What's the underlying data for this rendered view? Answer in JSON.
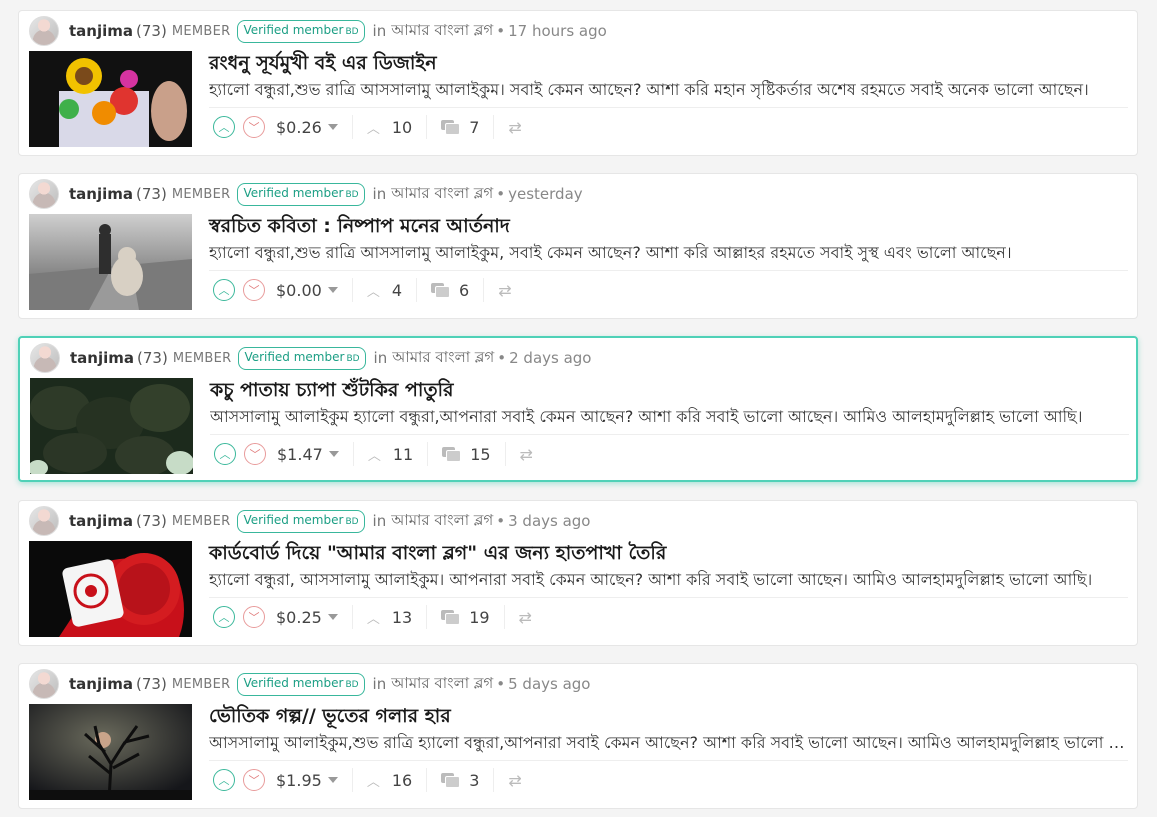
{
  "posts": [
    {
      "author": "tanjima",
      "reputation": "(73)",
      "role": "MEMBER",
      "badge": "Verified member",
      "badge_sub": "BD",
      "in_label": "in",
      "community": "আমার বাংলা ব্লগ",
      "time": "17 hours ago",
      "title": "রংধনু সূর্যমুখী বই এর ডিজাইন",
      "body": "হ্যালো বন্ধুরা,শুভ রাত্রি আসসালামু আলাইকুম। সবাই কেমন আছেন? আশা করি মহান সৃষ্টিকর্তার অশেষ রহমতে সবাই অনেক ভালো আছেন।",
      "payout": "$0.26",
      "votes": "10",
      "replies": "7",
      "highlighted": false
    },
    {
      "author": "tanjima",
      "reputation": "(73)",
      "role": "MEMBER",
      "badge": "Verified member",
      "badge_sub": "BD",
      "in_label": "in",
      "community": "আমার বাংলা ব্লগ",
      "time": "yesterday",
      "title": "স্বরচিত কবিতা : নিষ্পাপ মনের আর্তনাদ",
      "body": "হ্যালো বন্ধুরা,শুভ রাত্রি আসসালামু আলাইকুম, সবাই কেমন আছেন? আশা করি আল্লাহর রহমতে সবাই সুস্থ এবং ভালো আছেন।",
      "payout": "$0.00",
      "votes": "4",
      "replies": "6",
      "highlighted": false
    },
    {
      "author": "tanjima",
      "reputation": "(73)",
      "role": "MEMBER",
      "badge": "Verified member",
      "badge_sub": "BD",
      "in_label": "in",
      "community": "আমার বাংলা ব্লগ",
      "time": "2 days ago",
      "title": "কচু পাতায় চ্যাপা শুঁটকির পাতুরি",
      "body": "আসসালামু আলাইকুম হ্যালো বন্ধুরা,আপনারা সবাই কেমন আছেন? আশা করি সবাই ভালো আছেন। আমিও আলহামদুলিল্লাহ ভালো আছি।",
      "payout": "$1.47",
      "votes": "11",
      "replies": "15",
      "highlighted": true
    },
    {
      "author": "tanjima",
      "reputation": "(73)",
      "role": "MEMBER",
      "badge": "Verified member",
      "badge_sub": "BD",
      "in_label": "in",
      "community": "আমার বাংলা ব্লগ",
      "time": "3 days ago",
      "title": "কার্ডবোর্ড দিয়ে \"আমার বাংলা ব্লগ\" এর জন্য হাতপাখা তৈরি",
      "body": "হ্যালো বন্ধুরা, আসসালামু আলাইকুম। আপনারা সবাই কেমন আছেন? আশা করি সবাই ভালো আছেন। আমিও আলহামদুলিল্লাহ ভালো আছি।",
      "payout": "$0.25",
      "votes": "13",
      "replies": "19",
      "highlighted": false
    },
    {
      "author": "tanjima",
      "reputation": "(73)",
      "role": "MEMBER",
      "badge": "Verified member",
      "badge_sub": "BD",
      "in_label": "in",
      "community": "আমার বাংলা ব্লগ",
      "time": "5 days ago",
      "title": "ভৌতিক গল্প// ভূতের গলার হার",
      "body": "আসসালামু আলাইকুম,শুভ রাত্রি হ্যালো বন্ধুরা,আপনারা সবাই কেমন আছেন? আশা করি সবাই ভালো আছেন। আমিও আলহামদুলিল্লাহ ভালো আছি।",
      "payout": "$1.95",
      "votes": "16",
      "replies": "3",
      "highlighted": false
    }
  ],
  "icons": {
    "upvote": "chevron-up-icon",
    "downvote": "chevron-down-icon",
    "payout_dropdown": "caret-down-icon",
    "votes": "chevron-up-icon",
    "comments": "comments-icon",
    "reblog": "reblog-icon"
  },
  "colors": {
    "accent": "#4fd1b7",
    "upvote": "#3bb89b",
    "downvote": "#e07a7a"
  }
}
